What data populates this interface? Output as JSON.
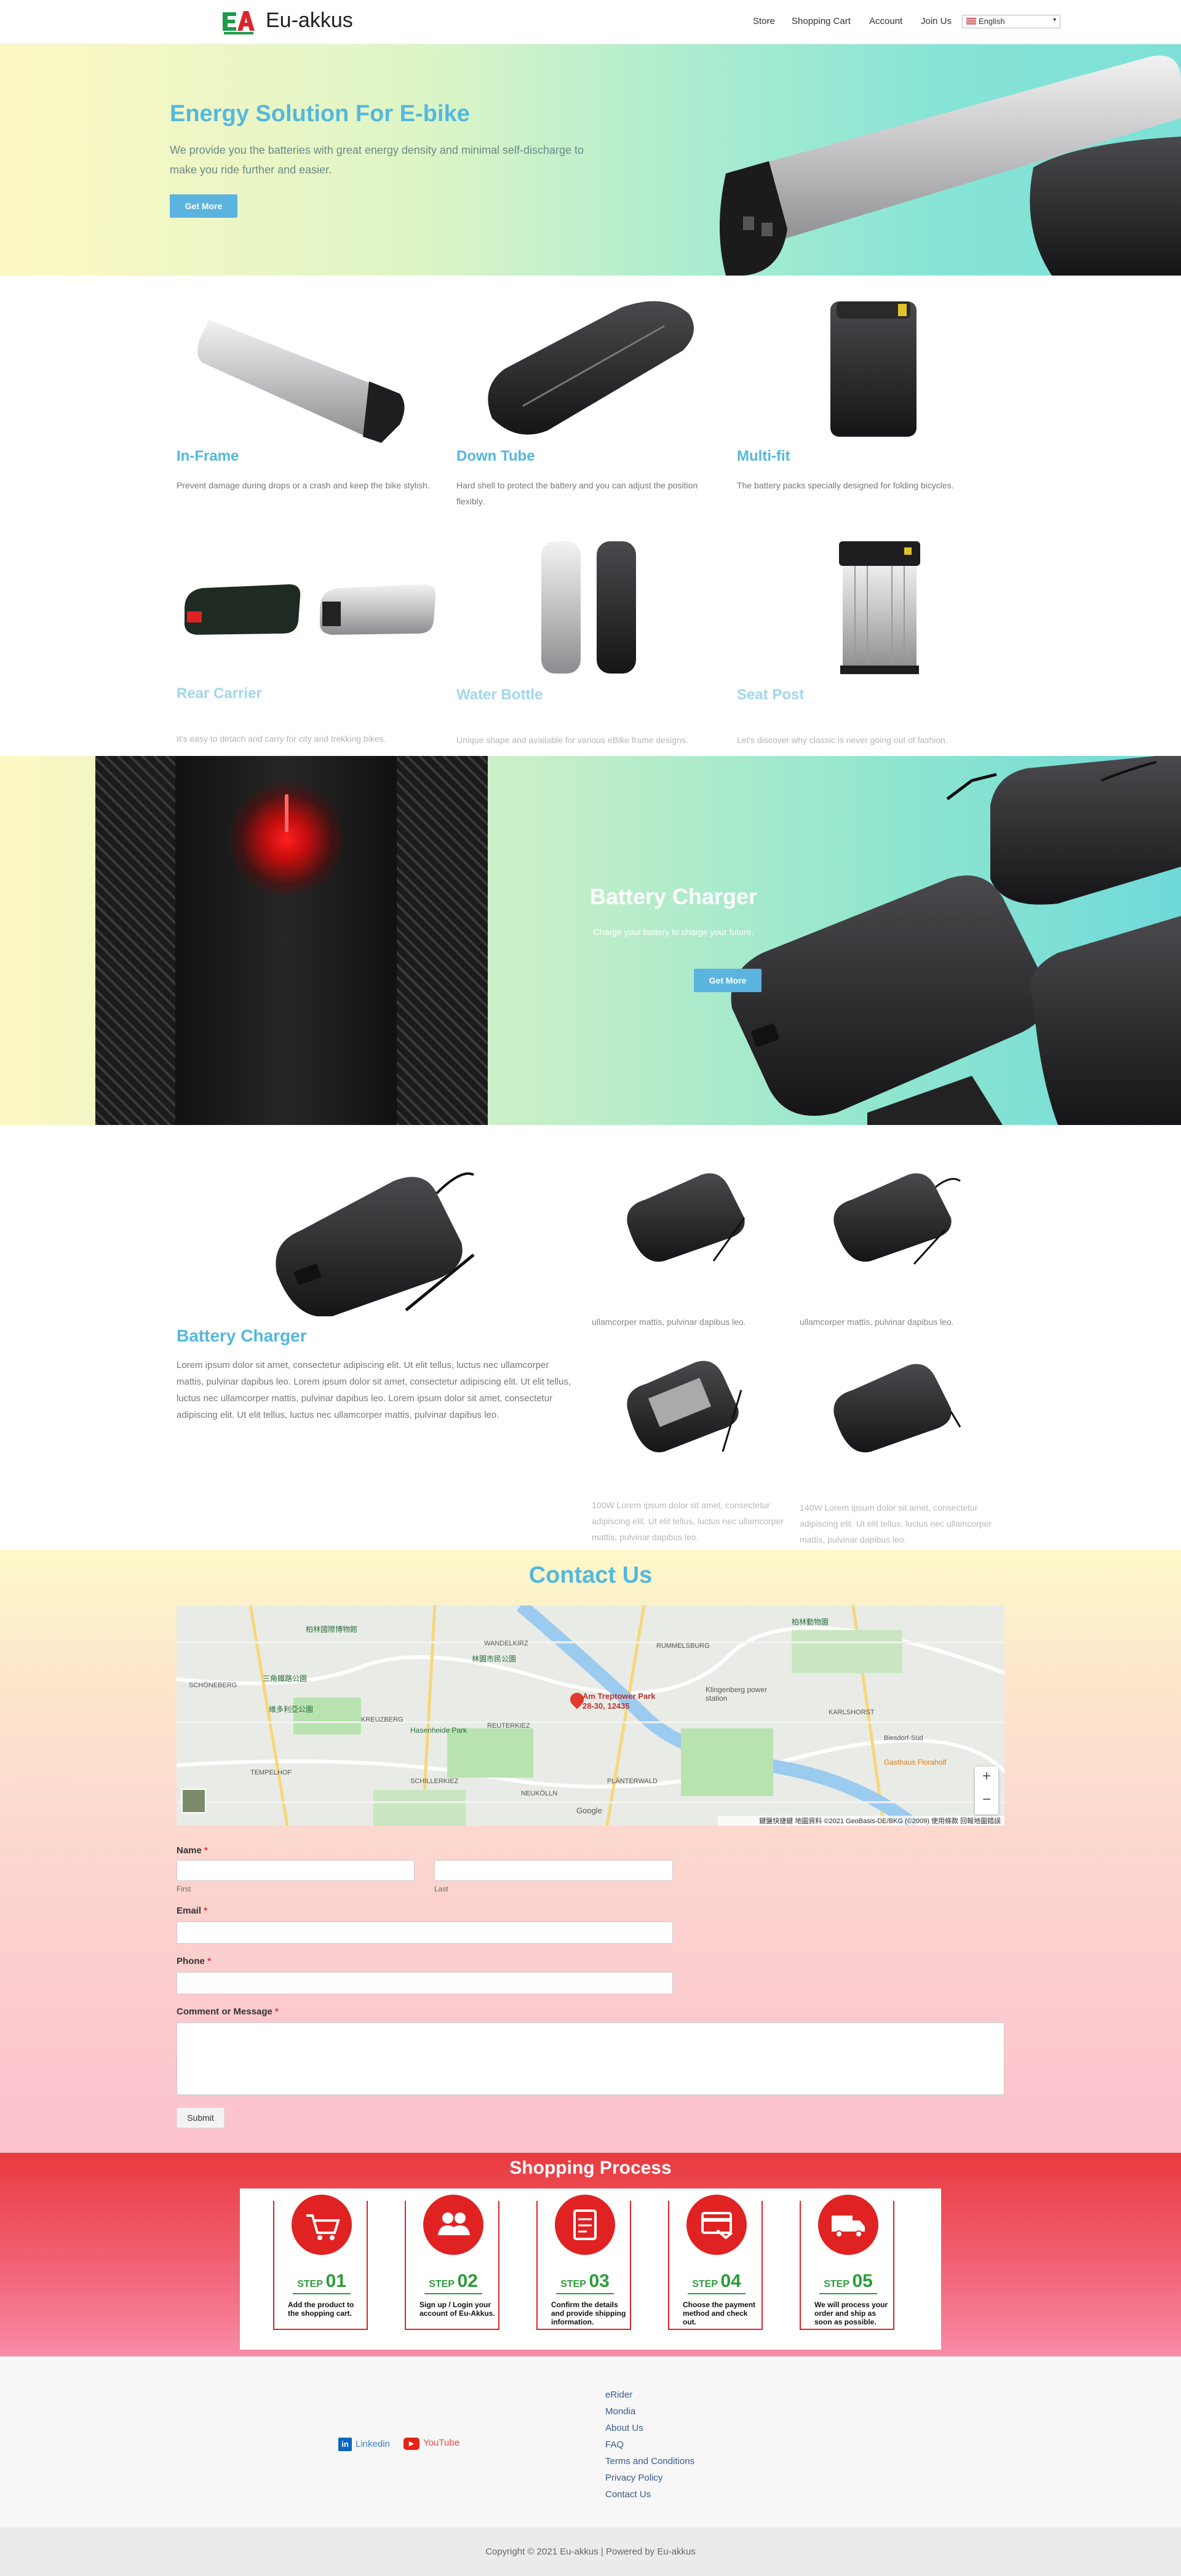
{
  "header": {
    "site_name": "Eu-akkus",
    "logo_text": "EA",
    "nav": [
      "Store",
      "Shopping Cart",
      "Account",
      "Join Us"
    ],
    "language": "English"
  },
  "hero": {
    "title": "Energy Solution For E-bike",
    "subtitle": "We provide you the batteries with great energy density and minimal self-discharge to make you ride further and easier.",
    "button": "Get More"
  },
  "categories": [
    {
      "title": "In-Frame",
      "desc": "Prevent damage during drops or a crash and keep the bike stylish."
    },
    {
      "title": "Down Tube",
      "desc": "Hard shell to protect the battery and you can adjust the position flexibly."
    },
    {
      "title": "Multi-fit",
      "desc": "The battery packs specially designed for folding bicycles."
    },
    {
      "title": "Rear Carrier",
      "desc": "It's easy to detach and carry for city and trekking bikes."
    },
    {
      "title": "Water Bottle",
      "desc": "Unique shape and available for various eBike frame designs."
    },
    {
      "title": "Seat Post",
      "desc": "Let's discover why classic is never going out of fashion."
    }
  ],
  "charger_banner": {
    "title": "Battery Charger",
    "subtitle": "Charge your battery to charge your future.",
    "button": "Get More"
  },
  "charger_section": {
    "title": "Battery Charger",
    "desc": "Lorem ipsum dolor sit amet, consectetur adipiscing elit. Ut elit tellus, luctus nec ullamcorper mattis, pulvinar dapibus leo. Lorem ipsum dolor sit amet, consectetur adipiscing elit. Ut elit tellus, luctus nec ullamcorper mattis, pulvinar dapibus leo. Lorem ipsum dolor sit amet, consectetur adipiscing elit. Ut elit tellus, luctus nec ullamcorper mattis, pulvinar dapibus leo.",
    "item_texts": [
      "ullamcorper mattis, pulvinar dapibus leo.",
      "ullamcorper mattis, pulvinar dapibus leo.",
      "100W Lorem ipsum dolor sit amet, consectetur adipiscing elit. Ut elit tellus, luctus nec ullamcorper mattis, pulvinar dapibus leo.",
      "140W Lorem ipsum dolor sit amet, consectetur adipiscing elit. Ut elit tellus, luctus nec ullamcorper mattis, pulvinar dapibus leo."
    ]
  },
  "contact": {
    "title": "Contact Us",
    "map": {
      "pin_label": "Am Treptower Park 28-30, 12435",
      "attribution": "鍵盤快捷鍵   地圖資料 ©2021 GeoBasis-DE/BKG (©2009)   使用條款   回報地圖錯誤",
      "google": "Google",
      "zoom_in": "+",
      "zoom_out": "−",
      "places": [
        "柏林國際博物館",
        "WANDELKIRZ",
        "林園市民公園",
        "RUMMELSBURG",
        "柏林動物園",
        "三角鐵路公園",
        "維多利亞公園",
        "Hasenheide Park",
        "KREUZBERG",
        "NEUKÖLLN",
        "PLÄNTERWALD",
        "KARLSHORST",
        "Biesdorf-Süd",
        "Gasthaus Floraholf",
        "Klingenberg power station",
        "SCHILLERKIEZ",
        "TEMPELHOF",
        "REUTERKIEZ",
        "SCHÖNEBERG"
      ]
    },
    "form": {
      "name_label": "Name",
      "first_hint": "First",
      "last_hint": "Last",
      "email_label": "Email",
      "phone_label": "Phone",
      "comment_label": "Comment or Message",
      "required_mark": "*",
      "submit": "Submit"
    }
  },
  "process": {
    "title": "Shopping Process",
    "step_word": "STEP",
    "steps": [
      {
        "num": "01",
        "text": "Add the product to the shopping cart."
      },
      {
        "num": "02",
        "text": "Sign up / Login your account of Eu-Akkus."
      },
      {
        "num": "03",
        "text": "Confirm the details and provide shipping information."
      },
      {
        "num": "04",
        "text": "Choose the payment method and check out."
      },
      {
        "num": "05",
        "text": "We will process your order and ship as soon as possible."
      }
    ]
  },
  "footer": {
    "social": [
      {
        "label": "Linkedin",
        "icon": "in"
      },
      {
        "label": "YouTube",
        "icon": "▶"
      }
    ],
    "links": [
      "eRider",
      "Mondia",
      "About Us",
      "FAQ",
      "Terms and Conditions",
      "Privacy Policy",
      "Contact Us"
    ],
    "copyright": "Copyright © 2021 Eu-akkus | Powered by Eu-akkus"
  },
  "colors": {
    "accent": "#54b8de",
    "button": "#5ab4df",
    "process_red": "#e02222",
    "step_green": "#2a9d3a"
  }
}
